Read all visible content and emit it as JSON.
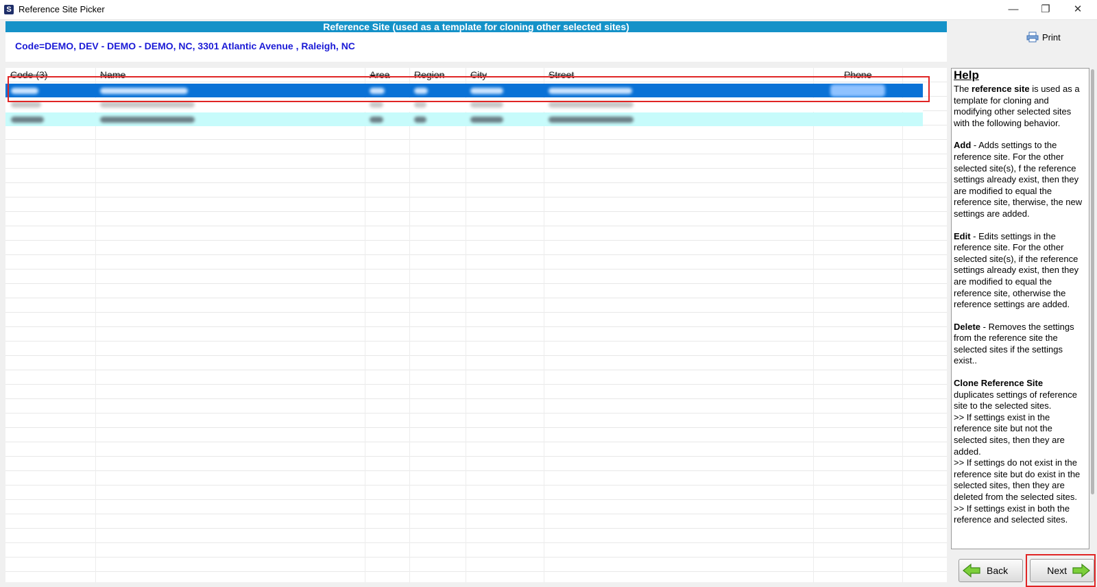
{
  "window": {
    "title": "Reference Site Picker"
  },
  "banner": {
    "title": "Reference Site (used as a template for cloning other selected sites)",
    "code_line": "Code=DEMO,  DEV - DEMO - DEMO, NC, 3301 Atlantic Avenue , Raleigh, NC"
  },
  "toolbar": {
    "print_label": "Print"
  },
  "grid": {
    "columns": [
      "Code (3)",
      "Name",
      "Area",
      "Region",
      "City",
      "Street",
      "Phone"
    ],
    "selected_row_index": 0
  },
  "help": {
    "title": "Help",
    "intro_pre": "The ",
    "intro_bold": "reference site",
    "intro_post": " is used as a template for cloning and modifying other selected sites with the following behavior.",
    "add_title": "Add",
    "add_text": " - Adds settings to the reference site.  For the other selected site(s), f the reference settings already exist, then they are modified to equal the reference site, therwise, the new settings are added.",
    "edit_title": "Edit",
    "edit_text": " - Edits settings in the reference site.  For the other selected site(s), if the reference settings already exist, then they are modified to equal the reference site, otherwise the reference settings are added.",
    "delete_title": "Delete",
    "delete_text": " - Removes the settings from the reference site the selected sites if the settings exist..",
    "clone_title": "Clone Reference Site",
    "clone_text": "duplicates settings of reference site to the selected sites.",
    "clone_bullet1": ">> If settings exist in the reference site but not the selected sites, then they are added.",
    "clone_bullet2": ">> If settings do not exist in the reference site but do exist in the selected sites, then they are deleted from the selected sites.",
    "clone_bullet3": ">> If settings exist in both the reference and selected sites."
  },
  "footer": {
    "back_label": "Back",
    "next_label": "Next"
  },
  "colors": {
    "banner": "#1592c8",
    "selected_row": "#0a72d6",
    "highlight_row": "#c7fbfb",
    "code_text": "#1a1ad6",
    "annotation": "#e02424"
  }
}
